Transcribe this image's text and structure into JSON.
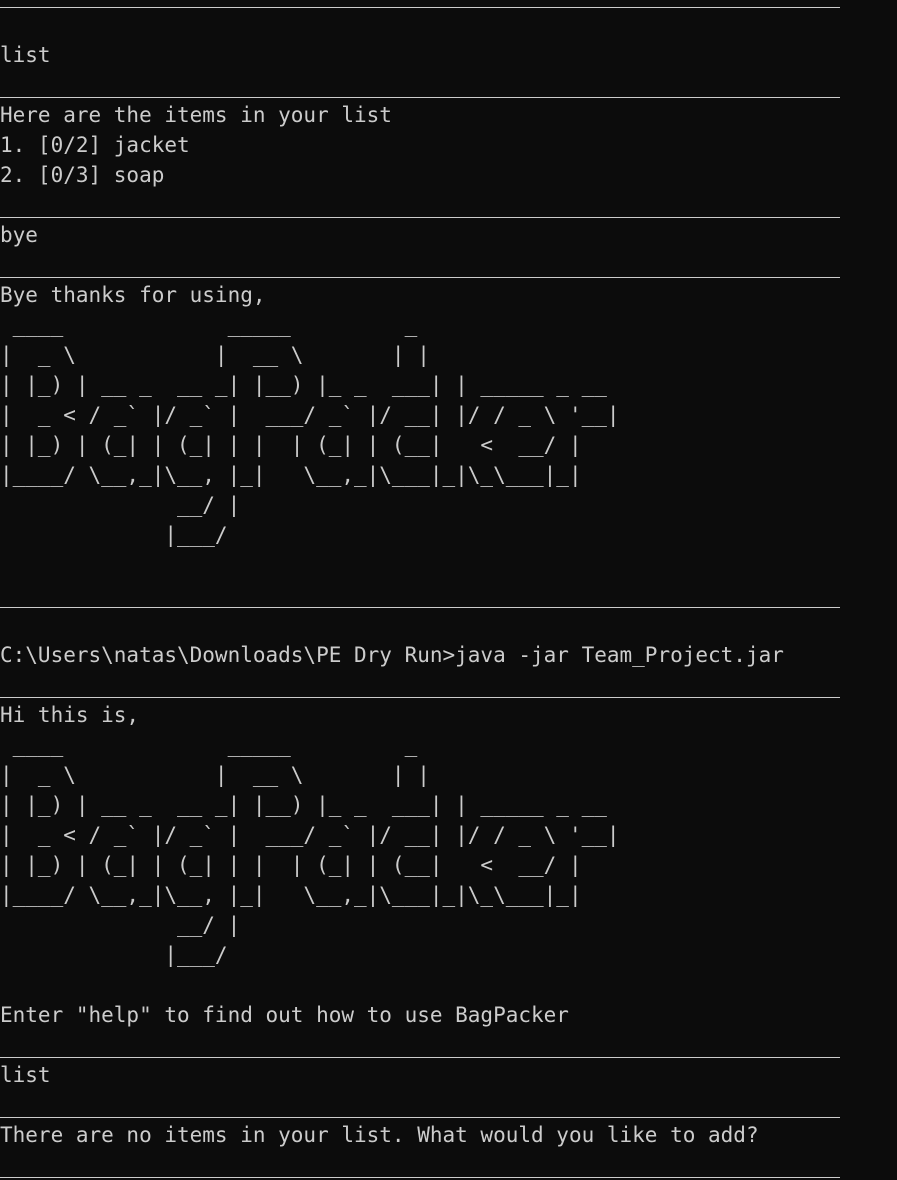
{
  "terminal": {
    "lines": [
      {
        "type": "sep-first"
      },
      {
        "type": "text",
        "name": "user-command",
        "text": "list"
      },
      {
        "type": "sep"
      },
      {
        "type": "text",
        "name": "output-text",
        "text": "Here are the items in your list"
      },
      {
        "type": "text",
        "name": "list-item",
        "text": "1. [0/2] jacket"
      },
      {
        "type": "text",
        "name": "list-item",
        "text": "2. [0/3] soap"
      },
      {
        "type": "sep"
      },
      {
        "type": "text",
        "name": "user-command",
        "text": "bye"
      },
      {
        "type": "sep"
      },
      {
        "type": "text",
        "name": "output-text",
        "text": "Bye thanks for using,"
      },
      {
        "type": "text",
        "name": "ascii-logo-line",
        "text": " ____             _____         _"
      },
      {
        "type": "text",
        "name": "ascii-logo-line",
        "text": "|  _ \\           |  __ \\       | |"
      },
      {
        "type": "text",
        "name": "ascii-logo-line",
        "text": "| |_) | __ _  __ _| |__) |_ _  ___| | _____ _ __"
      },
      {
        "type": "text",
        "name": "ascii-logo-line",
        "text": "|  _ < / _` |/ _` |  ___/ _` |/ __| |/ / _ \\ '__|"
      },
      {
        "type": "text",
        "name": "ascii-logo-line",
        "text": "| |_) | (_| | (_| | |  | (_| | (__|   <  __/ |"
      },
      {
        "type": "text",
        "name": "ascii-logo-line",
        "text": "|____/ \\__,_|\\__, |_|   \\__,_|\\___|_|\\_\\___|_|"
      },
      {
        "type": "text",
        "name": "ascii-logo-line",
        "text": "              __/ |"
      },
      {
        "type": "text",
        "name": "ascii-logo-line",
        "text": "             |___/"
      },
      {
        "type": "blank"
      },
      {
        "type": "sep"
      },
      {
        "type": "blank"
      },
      {
        "type": "text",
        "name": "shell-prompt",
        "text": "C:\\Users\\natas\\Downloads\\PE Dry Run>java -jar Team_Project.jar"
      },
      {
        "type": "sep"
      },
      {
        "type": "text",
        "name": "output-text",
        "text": "Hi this is,"
      },
      {
        "type": "text",
        "name": "ascii-logo-line",
        "text": " ____             _____         _"
      },
      {
        "type": "text",
        "name": "ascii-logo-line",
        "text": "|  _ \\           |  __ \\       | |"
      },
      {
        "type": "text",
        "name": "ascii-logo-line",
        "text": "| |_) | __ _  __ _| |__) |_ _  ___| | _____ _ __"
      },
      {
        "type": "text",
        "name": "ascii-logo-line",
        "text": "|  _ < / _` |/ _` |  ___/ _` |/ __| |/ / _ \\ '__|"
      },
      {
        "type": "text",
        "name": "ascii-logo-line",
        "text": "| |_) | (_| | (_| | |  | (_| | (__|   <  __/ |"
      },
      {
        "type": "text",
        "name": "ascii-logo-line",
        "text": "|____/ \\__,_|\\__, |_|   \\__,_|\\___|_|\\_\\___|_|"
      },
      {
        "type": "text",
        "name": "ascii-logo-line",
        "text": "              __/ |"
      },
      {
        "type": "text",
        "name": "ascii-logo-line",
        "text": "             |___/"
      },
      {
        "type": "blank"
      },
      {
        "type": "text",
        "name": "output-text",
        "text": "Enter \"help\" to find out how to use BagPacker"
      },
      {
        "type": "sep"
      },
      {
        "type": "text",
        "name": "user-command",
        "text": "list"
      },
      {
        "type": "sep"
      },
      {
        "type": "text",
        "name": "output-text",
        "text": "There are no items in your list. What would you like to add?"
      },
      {
        "type": "sep"
      }
    ]
  },
  "colors": {
    "background": "#0c0c0c",
    "foreground": "#cccccc"
  }
}
